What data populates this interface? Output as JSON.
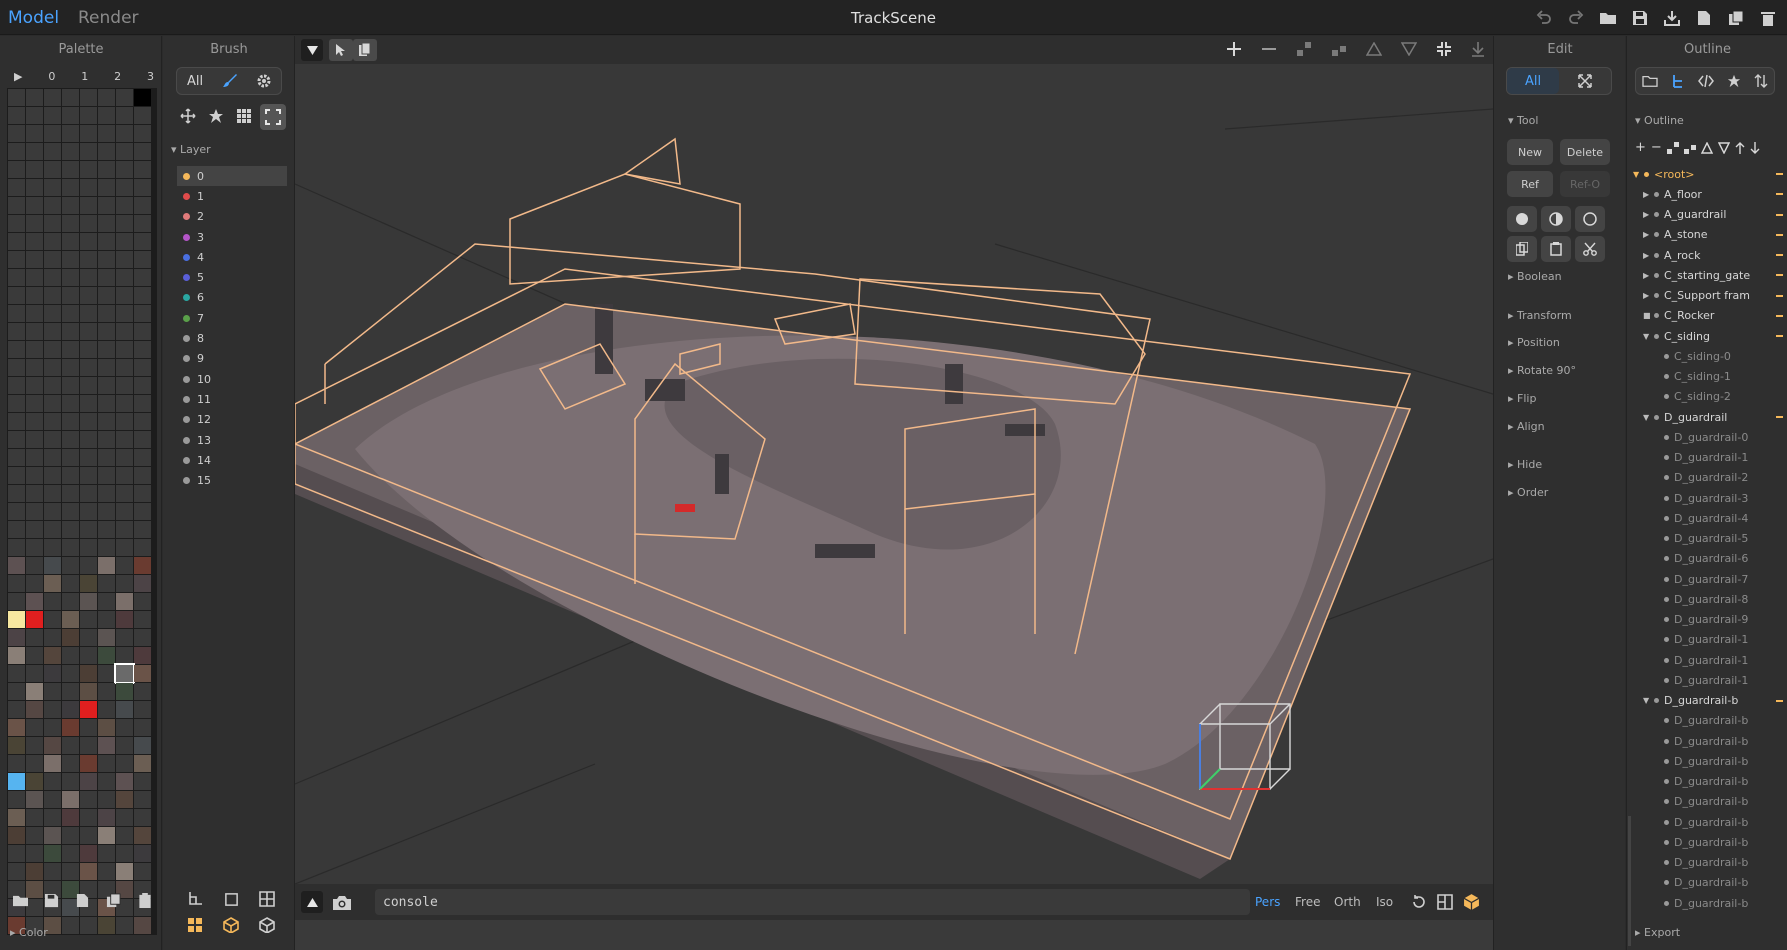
{
  "titlebar": {
    "model_tab": "Model",
    "render_tab": "Render",
    "title": "TrackScene",
    "icons": [
      "undo-icon",
      "redo-icon",
      "open-folder-icon",
      "save-icon",
      "export-icon",
      "new-file-icon",
      "duplicate-icon",
      "trash-icon"
    ]
  },
  "palette": {
    "title": "Palette",
    "head": [
      "▶",
      "0",
      "1",
      "2",
      "3"
    ],
    "colors": {
      "empty": "#3a3a3a",
      "black": "#000000",
      "cream": "#f6e7a0",
      "red": "#e01f1f",
      "blue": "#56b4f0",
      "selected_border": "#ffffff"
    },
    "footer_toggle": "Color"
  },
  "brush": {
    "title": "Brush",
    "filter_label": "All",
    "section": "Layer",
    "layers": [
      {
        "label": "0",
        "color": "#f5b85a"
      },
      {
        "label": "1",
        "color": "#e04b4b"
      },
      {
        "label": "2",
        "color": "#e07a7a"
      },
      {
        "label": "3",
        "color": "#b455c8"
      },
      {
        "label": "4",
        "color": "#4a6fe0"
      },
      {
        "label": "5",
        "color": "#5a5fd8"
      },
      {
        "label": "6",
        "color": "#2aa7a2"
      },
      {
        "label": "7",
        "color": "#5aa04a"
      },
      {
        "label": "8",
        "color": "#9a9a9a"
      },
      {
        "label": "9",
        "color": "#9a9a9a"
      },
      {
        "label": "10",
        "color": "#9a9a9a"
      },
      {
        "label": "11",
        "color": "#9a9a9a"
      },
      {
        "label": "12",
        "color": "#9a9a9a"
      },
      {
        "label": "13",
        "color": "#9a9a9a"
      },
      {
        "label": "14",
        "color": "#9a9a9a"
      },
      {
        "label": "15",
        "color": "#9a9a9a"
      }
    ]
  },
  "viewport": {
    "console_value": "console",
    "modes": [
      "Pers",
      "Free",
      "Orth",
      "Iso"
    ],
    "active_mode": "Pers",
    "colors": {
      "wire": "#f2b98a",
      "track": "#7c6f72",
      "accent": "#4aa3ff"
    }
  },
  "edit": {
    "title": "Edit",
    "filter_label": "All",
    "tool_section": "Tool",
    "new_label": "New",
    "delete_label": "Delete",
    "ref_label": "Ref",
    "refo_label": "Ref-O",
    "sections": [
      "Boolean",
      "Transform",
      "Position",
      "Rotate 90°",
      "Flip",
      "Align",
      "Hide",
      "Order"
    ]
  },
  "outline": {
    "title": "Outline",
    "section": "Outline",
    "tree": [
      {
        "label": "<root>",
        "level": 0,
        "caret": "▼",
        "root": true
      },
      {
        "label": "A_floor",
        "level": 1,
        "caret": "▶"
      },
      {
        "label": "A_guardrail",
        "level": 1,
        "caret": "▶"
      },
      {
        "label": "A_stone",
        "level": 1,
        "caret": "▶"
      },
      {
        "label": "A_rock",
        "level": 1,
        "caret": "▶"
      },
      {
        "label": "C_starting_gate",
        "level": 1,
        "caret": "▶"
      },
      {
        "label": "C_Support fram",
        "level": 1,
        "caret": "▶"
      },
      {
        "label": "C_Rocker",
        "level": 1,
        "caret": "■"
      },
      {
        "label": "C_siding",
        "level": 1,
        "caret": "▼"
      },
      {
        "label": "C_siding-0",
        "level": 2,
        "caret": ""
      },
      {
        "label": "C_siding-1",
        "level": 2,
        "caret": ""
      },
      {
        "label": "C_siding-2",
        "level": 2,
        "caret": ""
      },
      {
        "label": "D_guardrail",
        "level": 1,
        "caret": "▼"
      },
      {
        "label": "D_guardrail-0",
        "level": 2,
        "caret": ""
      },
      {
        "label": "D_guardrail-1",
        "level": 2,
        "caret": ""
      },
      {
        "label": "D_guardrail-2",
        "level": 2,
        "caret": ""
      },
      {
        "label": "D_guardrail-3",
        "level": 2,
        "caret": ""
      },
      {
        "label": "D_guardrail-4",
        "level": 2,
        "caret": ""
      },
      {
        "label": "D_guardrail-5",
        "level": 2,
        "caret": ""
      },
      {
        "label": "D_guardrail-6",
        "level": 2,
        "caret": ""
      },
      {
        "label": "D_guardrail-7",
        "level": 2,
        "caret": ""
      },
      {
        "label": "D_guardrail-8",
        "level": 2,
        "caret": ""
      },
      {
        "label": "D_guardrail-9",
        "level": 2,
        "caret": ""
      },
      {
        "label": "D_guardrail-1",
        "level": 2,
        "caret": ""
      },
      {
        "label": "D_guardrail-1",
        "level": 2,
        "caret": ""
      },
      {
        "label": "D_guardrail-1",
        "level": 2,
        "caret": ""
      },
      {
        "label": "D_guardrail-b",
        "level": 1,
        "caret": "▼"
      },
      {
        "label": "D_guardrail-b",
        "level": 2,
        "caret": ""
      },
      {
        "label": "D_guardrail-b",
        "level": 2,
        "caret": ""
      },
      {
        "label": "D_guardrail-b",
        "level": 2,
        "caret": ""
      },
      {
        "label": "D_guardrail-b",
        "level": 2,
        "caret": ""
      },
      {
        "label": "D_guardrail-b",
        "level": 2,
        "caret": ""
      },
      {
        "label": "D_guardrail-b",
        "level": 2,
        "caret": ""
      },
      {
        "label": "D_guardrail-b",
        "level": 2,
        "caret": ""
      },
      {
        "label": "D_guardrail-b",
        "level": 2,
        "caret": ""
      },
      {
        "label": "D_guardrail-b",
        "level": 2,
        "caret": ""
      },
      {
        "label": "D_guardrail-b",
        "level": 2,
        "caret": ""
      }
    ],
    "footer_toggle": "Export"
  }
}
